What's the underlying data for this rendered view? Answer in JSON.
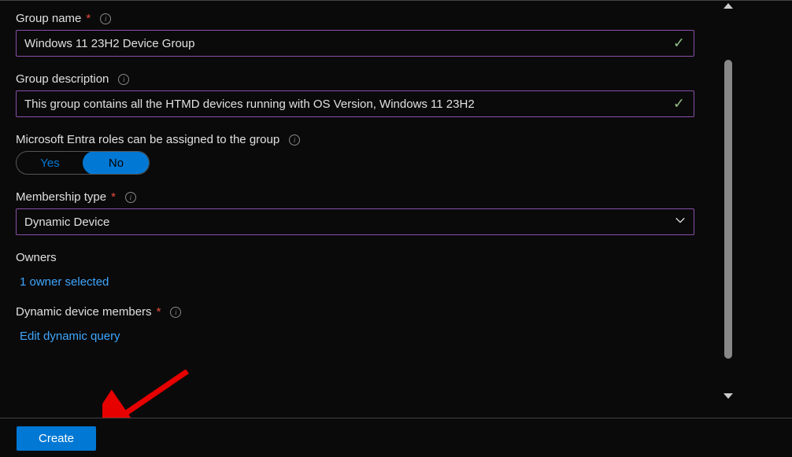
{
  "groupName": {
    "label": "Group name",
    "value": "Windows 11 23H2 Device Group",
    "required": true
  },
  "groupDescription": {
    "label": "Group description",
    "value": "This group contains all the HTMD devices running with OS Version, Windows 11 23H2",
    "required": false
  },
  "entraRoles": {
    "label": "Microsoft Entra roles can be assigned to the group",
    "yesLabel": "Yes",
    "noLabel": "No",
    "selected": "No"
  },
  "membershipType": {
    "label": "Membership type",
    "value": "Dynamic Device",
    "required": true
  },
  "owners": {
    "label": "Owners",
    "linkText": "1 owner selected"
  },
  "dynamicMembers": {
    "label": "Dynamic device members",
    "linkText": "Edit dynamic query",
    "required": true
  },
  "footer": {
    "createButton": "Create"
  }
}
